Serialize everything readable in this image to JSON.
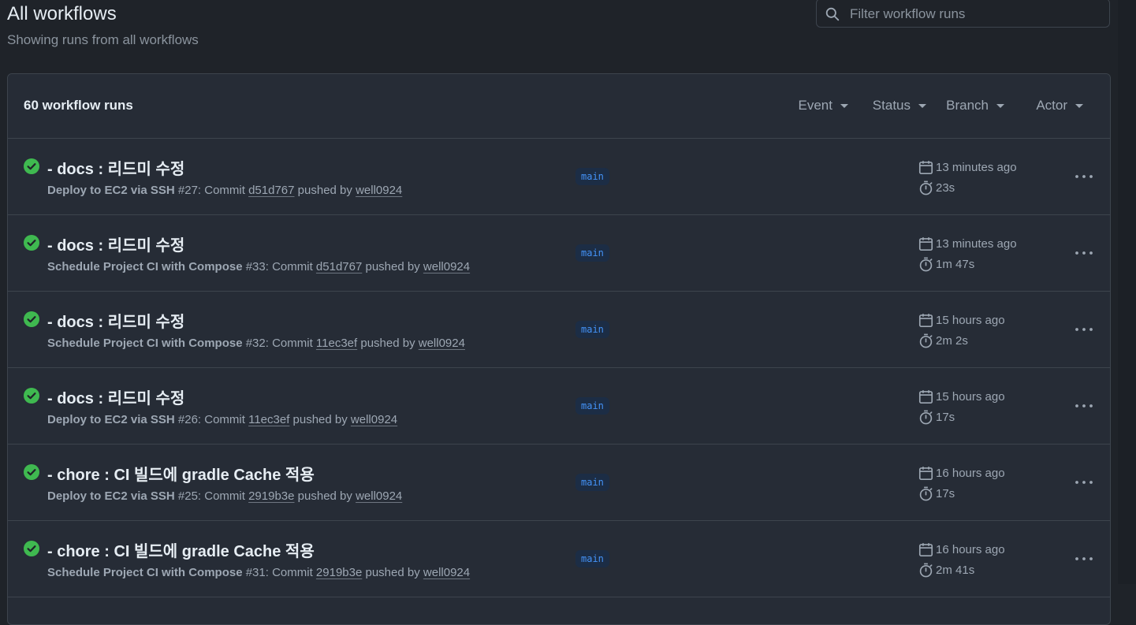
{
  "header": {
    "title": "All workflows",
    "subtitle": "Showing runs from all workflows"
  },
  "search": {
    "placeholder": "Filter workflow runs"
  },
  "panel": {
    "run_count": "60 workflow runs",
    "filters": [
      "Event",
      "Status",
      "Branch",
      "Actor"
    ]
  },
  "runs": [
    {
      "title": "- docs : 리드미 수정",
      "workflow": "Deploy to EC2 via SSH",
      "number": "#27",
      "commit_label": ": Commit ",
      "commit": "d51d767",
      "pushed_by": " pushed by ",
      "actor": "well0924",
      "branch": "main",
      "time": "13 minutes ago",
      "duration": "23s",
      "status": "success"
    },
    {
      "title": "- docs : 리드미 수정",
      "workflow": "Schedule Project CI with Compose",
      "number": "#33",
      "commit_label": ": Commit ",
      "commit": "d51d767",
      "pushed_by": " pushed by ",
      "actor": "well0924",
      "branch": "main",
      "time": "13 minutes ago",
      "duration": "1m 47s",
      "status": "success"
    },
    {
      "title": "- docs : 리드미 수정",
      "workflow": "Schedule Project CI with Compose",
      "number": "#32",
      "commit_label": ": Commit ",
      "commit": "11ec3ef",
      "pushed_by": " pushed by ",
      "actor": "well0924",
      "branch": "main",
      "time": "15 hours ago",
      "duration": "2m 2s",
      "status": "success"
    },
    {
      "title": "- docs : 리드미 수정",
      "workflow": "Deploy to EC2 via SSH",
      "number": "#26",
      "commit_label": ": Commit ",
      "commit": "11ec3ef",
      "pushed_by": " pushed by ",
      "actor": "well0924",
      "branch": "main",
      "time": "15 hours ago",
      "duration": "17s",
      "status": "success"
    },
    {
      "title": "- chore : CI 빌드에 gradle Cache 적용",
      "workflow": "Deploy to EC2 via SSH",
      "number": "#25",
      "commit_label": ": Commit ",
      "commit": "2919b3e",
      "pushed_by": " pushed by ",
      "actor": "well0924",
      "branch": "main",
      "time": "16 hours ago",
      "duration": "17s",
      "status": "success"
    },
    {
      "title": "- chore : CI 빌드에 gradle Cache 적용",
      "workflow": "Schedule Project CI with Compose",
      "number": "#31",
      "commit_label": ": Commit ",
      "commit": "2919b3e",
      "pushed_by": " pushed by ",
      "actor": "well0924",
      "branch": "main",
      "time": "16 hours ago",
      "duration": "2m 41s",
      "status": "success"
    }
  ],
  "colors": {
    "success": "#3fb950",
    "branch_fg": "#4493f8",
    "branch_bg": "#1c2d45"
  }
}
